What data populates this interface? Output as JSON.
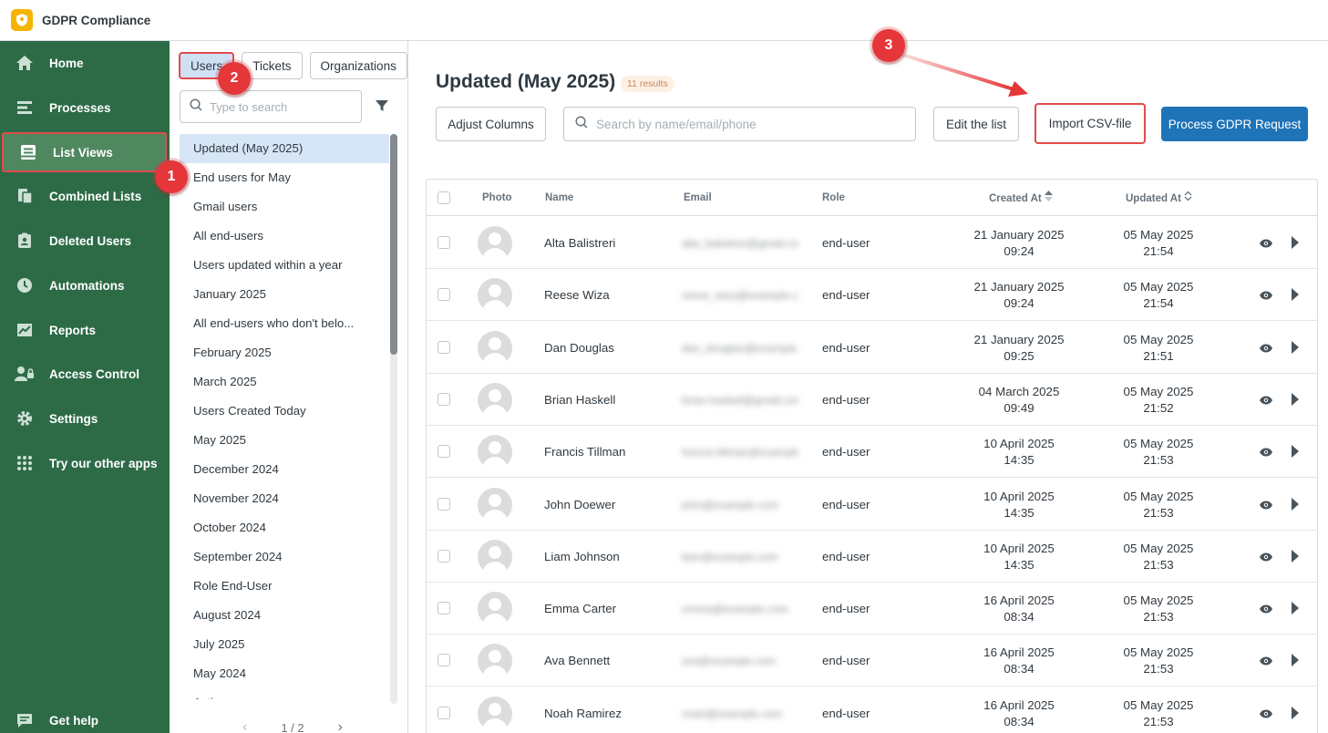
{
  "app": {
    "title": "GDPR Compliance"
  },
  "nav": {
    "items": [
      {
        "label": "Home",
        "icon": "home-icon"
      },
      {
        "label": "Processes",
        "icon": "processes-icon"
      },
      {
        "label": "List Views",
        "icon": "list-views-icon"
      },
      {
        "label": "Combined Lists",
        "icon": "combined-lists-icon"
      },
      {
        "label": "Deleted Users",
        "icon": "deleted-users-icon"
      },
      {
        "label": "Automations",
        "icon": "clock-icon"
      },
      {
        "label": "Reports",
        "icon": "chart-icon"
      },
      {
        "label": "Access Control",
        "icon": "user-lock-icon"
      },
      {
        "label": "Settings",
        "icon": "gear-icon"
      },
      {
        "label": "Try our other apps",
        "icon": "apps-grid-icon"
      }
    ],
    "active": "List Views",
    "help": "Get help"
  },
  "mid": {
    "tabs": [
      "Users",
      "Tickets",
      "Organizations"
    ],
    "active_tab": "Users",
    "search_placeholder": "Type to search",
    "lists": [
      "Updated (May 2025)",
      "End users for May",
      "Gmail users",
      "All end-users",
      "Users updated within a year",
      "January 2025",
      "All end-users who don't belo...",
      "February 2025",
      "March 2025",
      "Users Created Today",
      "May 2025",
      "December 2024",
      "November 2024",
      "October 2024",
      "September 2024",
      "Role End-User",
      "August 2024",
      "July 2025",
      "May 2024",
      "Active users"
    ],
    "pager": {
      "prev": "‹",
      "label": "1 / 2",
      "next": "›"
    }
  },
  "main": {
    "title": "Updated (May 2025)",
    "count": "11 results",
    "adjust_columns": "Adjust Columns",
    "search_placeholder": "Search by name/email/phone",
    "edit_list": "Edit the list",
    "import_csv": "Import CSV-file",
    "process_request": "Process GDPR Request"
  },
  "table": {
    "headers": {
      "photo": "Photo",
      "name": "Name",
      "email": "Email",
      "role": "Role",
      "created": "Created At",
      "updated": "Updated At"
    },
    "rows": [
      {
        "name": "Alta Balistreri",
        "email": "alta_balistreri@gmail.com",
        "role": "end-user",
        "created_date": "21 January 2025",
        "created_time": "09:24",
        "updated_date": "05 May 2025",
        "updated_time": "21:54"
      },
      {
        "name": "Reese Wiza",
        "email": "reese_wiza@example.com",
        "role": "end-user",
        "created_date": "21 January 2025",
        "created_time": "09:24",
        "updated_date": "05 May 2025",
        "updated_time": "21:54"
      },
      {
        "name": "Dan Douglas",
        "email": "dan_douglas@example.com",
        "role": "end-user",
        "created_date": "21 January 2025",
        "created_time": "09:25",
        "updated_date": "05 May 2025",
        "updated_time": "21:51"
      },
      {
        "name": "Brian Haskell",
        "email": "brian.haskell@gmail.com",
        "role": "end-user",
        "created_date": "04 March 2025",
        "created_time": "09:49",
        "updated_date": "05 May 2025",
        "updated_time": "21:52"
      },
      {
        "name": "Francis Tillman",
        "email": "francis.tillman@example.com",
        "role": "end-user",
        "created_date": "10 April 2025",
        "created_time": "14:35",
        "updated_date": "05 May 2025",
        "updated_time": "21:53"
      },
      {
        "name": "John Doewer",
        "email": "john@example.com",
        "role": "end-user",
        "created_date": "10 April 2025",
        "created_time": "14:35",
        "updated_date": "05 May 2025",
        "updated_time": "21:53"
      },
      {
        "name": "Liam Johnson",
        "email": "liam@example.com",
        "role": "end-user",
        "created_date": "10 April 2025",
        "created_time": "14:35",
        "updated_date": "05 May 2025",
        "updated_time": "21:53"
      },
      {
        "name": "Emma Carter",
        "email": "emma@example.com",
        "role": "end-user",
        "created_date": "16 April 2025",
        "created_time": "08:34",
        "updated_date": "05 May 2025",
        "updated_time": "21:53"
      },
      {
        "name": "Ava Bennett",
        "email": "ava@example.com",
        "role": "end-user",
        "created_date": "16 April 2025",
        "created_time": "08:34",
        "updated_date": "05 May 2025",
        "updated_time": "21:53"
      },
      {
        "name": "Noah Ramirez",
        "email": "noah@example.com",
        "role": "end-user",
        "created_date": "16 April 2025",
        "created_time": "08:34",
        "updated_date": "05 May 2025",
        "updated_time": "21:53"
      }
    ]
  },
  "annotations": {
    "markers": [
      "1",
      "2",
      "3"
    ]
  },
  "colors": {
    "sidebar": "#2d6b46",
    "sidebar_active": "#4f875f",
    "primary": "#1f73b7",
    "highlight": "#e34b4b",
    "selected_list": "#d6e6f6"
  }
}
